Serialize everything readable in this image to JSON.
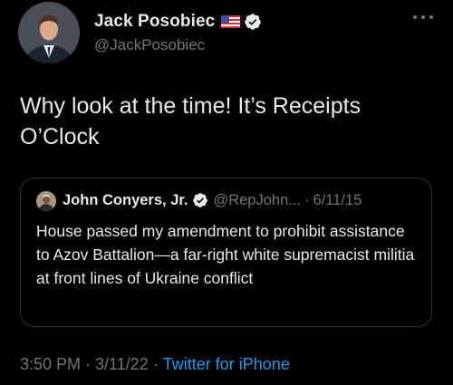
{
  "author": {
    "display_name": "Jack Posobiec",
    "handle": "@JackPosobiec",
    "flag_icon": "us-flag-icon",
    "verified_icon": "verified-badge-icon"
  },
  "menu": {
    "icon": "more-options-icon"
  },
  "tweet": {
    "text_line1": "Why look at the time! It’s Receipts",
    "text_line2": "O’Clock"
  },
  "quoted_tweet": {
    "display_name": "John Conyers, Jr.",
    "handle": "@RepJohn...",
    "separator": "·",
    "date": "6/11/15",
    "text": "House passed my amendment to prohibit assistance to Azov Battalion—a far-right white supremacist militia at front lines of Ukraine conflict"
  },
  "footer": {
    "time": "3:50 PM",
    "dot1": "·",
    "date": "3/11/22",
    "dot2": "·",
    "source": "Twitter for iPhone"
  },
  "colors": {
    "background": "#000000",
    "text": "#e7e9ea",
    "secondary_text": "#71767b",
    "link": "#1d9bf0",
    "verified": "#1d9bf0",
    "border": "#2f3336"
  }
}
